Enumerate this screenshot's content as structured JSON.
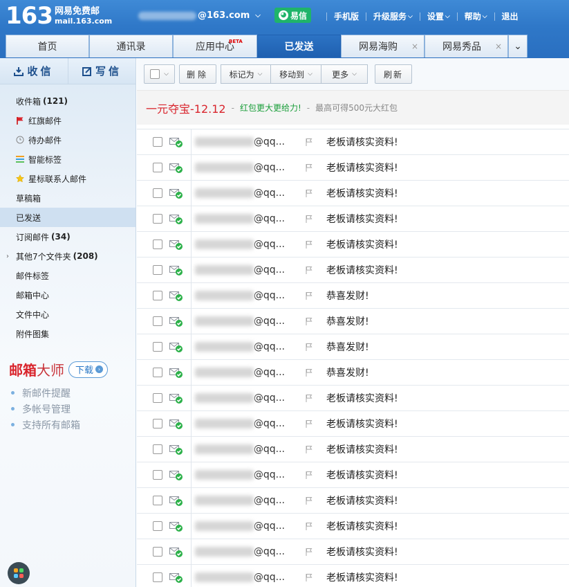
{
  "header": {
    "logo_number": "163",
    "logo_line1": "网易免费邮",
    "logo_line2": "mail.163.com",
    "account_domain": "@163.com",
    "yixin_label": "易信",
    "nav": [
      "手机版",
      "升级服务",
      "设置",
      "帮助",
      "退出"
    ]
  },
  "tabs": {
    "home": "首页",
    "contacts": "通讯录",
    "apps": "应用中心",
    "apps_badge": "BETA",
    "sent": "已发送",
    "haigou": "网易海购",
    "xiupin": "网易秀品",
    "close": "×",
    "more": "⌄"
  },
  "sidebar": {
    "receive": "收信",
    "compose": "写信",
    "folders": {
      "inbox": {
        "label": "收件箱",
        "count": "(121)"
      },
      "flagged": {
        "label": "红旗邮件"
      },
      "todo": {
        "label": "待办邮件"
      },
      "smart": {
        "label": "智能标签"
      },
      "star": {
        "label": "星标联系人邮件"
      },
      "drafts": {
        "label": "草稿箱"
      },
      "sent": {
        "label": "已发送"
      },
      "subscribe": {
        "label": "订阅邮件",
        "count": "(34)"
      },
      "other": {
        "label": "其他7个文件夹",
        "count": "(208)"
      },
      "tags": {
        "label": "邮件标签"
      },
      "center": {
        "label": "邮箱中心"
      },
      "files": {
        "label": "文件中心"
      },
      "attachments": {
        "label": "附件图集"
      }
    },
    "promo": {
      "brand1": "邮箱",
      "brand2": "大师",
      "download": "下载",
      "items": [
        "新邮件提醒",
        "多帐号管理",
        "支持所有邮箱"
      ]
    }
  },
  "toolbar": {
    "delete": "删除",
    "mark_as": "标记为",
    "move_to": "移动到",
    "more": "更多",
    "refresh": "刷新"
  },
  "ad": {
    "title": "一元夺宝-12.12",
    "sep": "-",
    "text1": "红包更大更给力!",
    "text2": "最高可得500元大红包"
  },
  "emails": [
    {
      "sender": "@qq...",
      "subject": "老板请核实资料!"
    },
    {
      "sender": "@qq...",
      "subject": "老板请核实资料!"
    },
    {
      "sender": "@qq...",
      "subject": "老板请核实资料!"
    },
    {
      "sender": "@qq...",
      "subject": "老板请核实资料!"
    },
    {
      "sender": "@qq...",
      "subject": "老板请核实资料!"
    },
    {
      "sender": "@qq...",
      "subject": "老板请核实资料!"
    },
    {
      "sender": "@qq...",
      "subject": "恭喜发财!"
    },
    {
      "sender": "@qq...",
      "subject": "恭喜发财!"
    },
    {
      "sender": "@qq...",
      "subject": "恭喜发财!"
    },
    {
      "sender": "@qq...",
      "subject": "恭喜发财!"
    },
    {
      "sender": "@qq...",
      "subject": "老板请核实资料!"
    },
    {
      "sender": "@qq...",
      "subject": "老板请核实资料!"
    },
    {
      "sender": "@qq...",
      "subject": "老板请核实资料!"
    },
    {
      "sender": "@qq...",
      "subject": "老板请核实资料!"
    },
    {
      "sender": "@qq...",
      "subject": "老板请核实资料!"
    },
    {
      "sender": "@qq...",
      "subject": "老板请核实资料!"
    },
    {
      "sender": "@qq...",
      "subject": "老板请核实资料!"
    },
    {
      "sender": "@qq...",
      "subject": "老板请核实资料!"
    }
  ],
  "colors": {
    "header_blue": "#2f78c8",
    "active_tab": "#1f60b0",
    "yixin_green": "#1fb46a",
    "brand_red": "#d9242c"
  }
}
